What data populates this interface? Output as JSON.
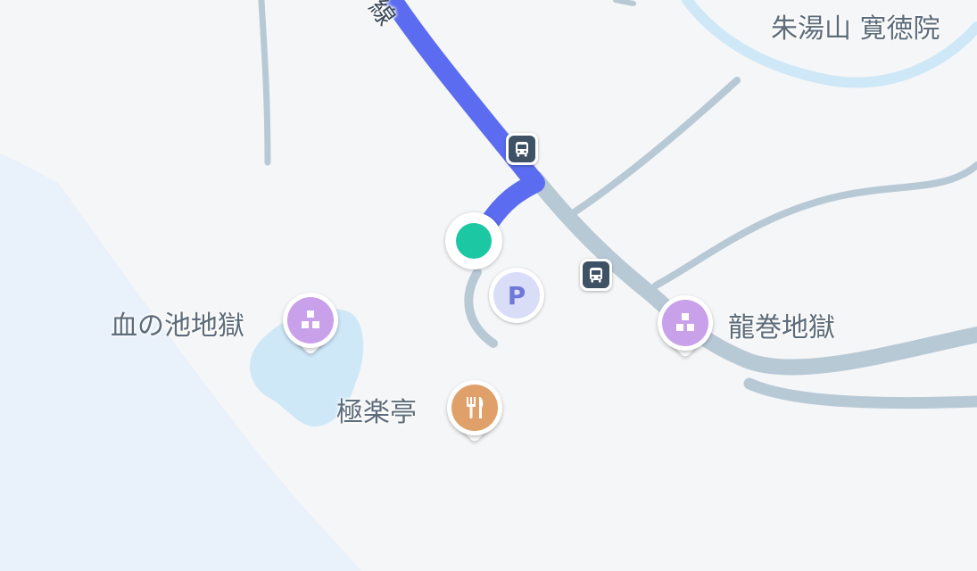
{
  "map": {
    "labels": {
      "temple": "朱湯山 寛徳院",
      "chinoike": "血の池地獄",
      "tatsumaki": "龍巻地獄",
      "gokurakutei": "極楽亭",
      "route_fragment": "線"
    },
    "poi_icons": {
      "chinoike": "sightseeing-blocks-icon",
      "tatsumaki": "sightseeing-blocks-icon",
      "gokurakutei": "restaurant-fork-knife-icon",
      "parking": "parking-icon",
      "bus_stop": "bus-icon"
    },
    "parking_symbol": "P"
  },
  "colors": {
    "land": "#f5f6f7",
    "sea": "#e9f1fb",
    "water": "#cfe8f8",
    "road": "#b8c9d6",
    "route": "#5b6cf0",
    "location": "#1cc7a3",
    "sightseeing_pin": "#c9a0ea",
    "restaurant_pin": "#e0a06a",
    "parking_bg": "#d9ddf8",
    "parking_text": "#6f78d8",
    "bus_stop": "#3e5165",
    "label_text": "#5d6c7a"
  }
}
